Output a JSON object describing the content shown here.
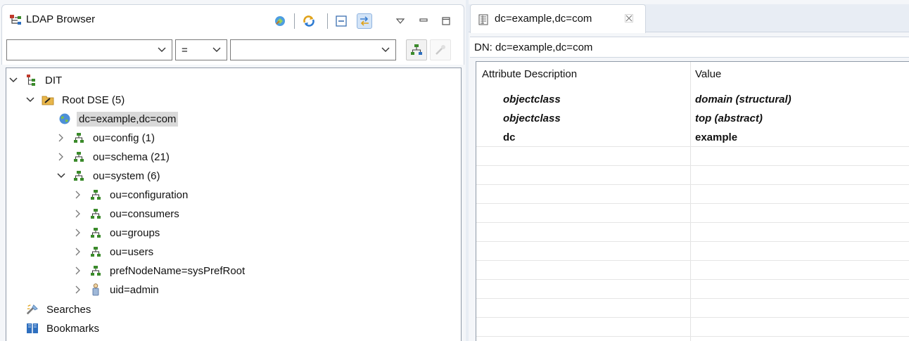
{
  "left_view": {
    "tab_label": "LDAP Browser",
    "filter": {
      "attribute": "",
      "operator": "=",
      "value": ""
    },
    "tree": [
      {
        "label": "DIT",
        "level": 0,
        "expanded": true,
        "icon": "dit-icon"
      },
      {
        "label": "Root DSE (5)",
        "level": 1,
        "expanded": true,
        "icon": "root-dse-icon"
      },
      {
        "label": "dc=example,dc=com",
        "level": 2,
        "leaf": true,
        "selected": true,
        "icon": "globe-icon"
      },
      {
        "label": "ou=config (1)",
        "level": 2,
        "expanded": false,
        "icon": "ou-icon"
      },
      {
        "label": "ou=schema (21)",
        "level": 2,
        "expanded": false,
        "icon": "ou-icon"
      },
      {
        "label": "ou=system (6)",
        "level": 2,
        "expanded": true,
        "icon": "ou-icon"
      },
      {
        "label": "ou=configuration",
        "level": 3,
        "expanded": false,
        "icon": "ou-icon"
      },
      {
        "label": "ou=consumers",
        "level": 3,
        "expanded": false,
        "icon": "ou-icon"
      },
      {
        "label": "ou=groups",
        "level": 3,
        "expanded": false,
        "icon": "ou-icon"
      },
      {
        "label": "ou=users",
        "level": 3,
        "expanded": false,
        "icon": "ou-icon"
      },
      {
        "label": "prefNodeName=sysPrefRoot",
        "level": 3,
        "expanded": false,
        "icon": "ou-icon"
      },
      {
        "label": "uid=admin",
        "level": 3,
        "expanded": false,
        "icon": "person-icon"
      },
      {
        "label": "Searches",
        "level": -1,
        "leaf": true,
        "icon": "searches-icon"
      },
      {
        "label": "Bookmarks",
        "level": -1,
        "leaf": true,
        "icon": "bookmarks-icon"
      }
    ]
  },
  "editor": {
    "tab_label": "dc=example,dc=com",
    "dn_label": "DN: dc=example,dc=com",
    "columns": [
      "Attribute Description",
      "Value"
    ],
    "rows": [
      {
        "attribute": "objectclass",
        "value": "domain (structural)",
        "italic": true
      },
      {
        "attribute": "objectclass",
        "value": "top (abstract)",
        "italic": true
      },
      {
        "attribute": "dc",
        "value": "example",
        "italic": false
      }
    ]
  },
  "colors": {
    "accent": "#3c7fd1",
    "selection": "#d9d9d9",
    "ou_icon": "#3a8a2a",
    "folder_icon": "#e8b64a"
  }
}
